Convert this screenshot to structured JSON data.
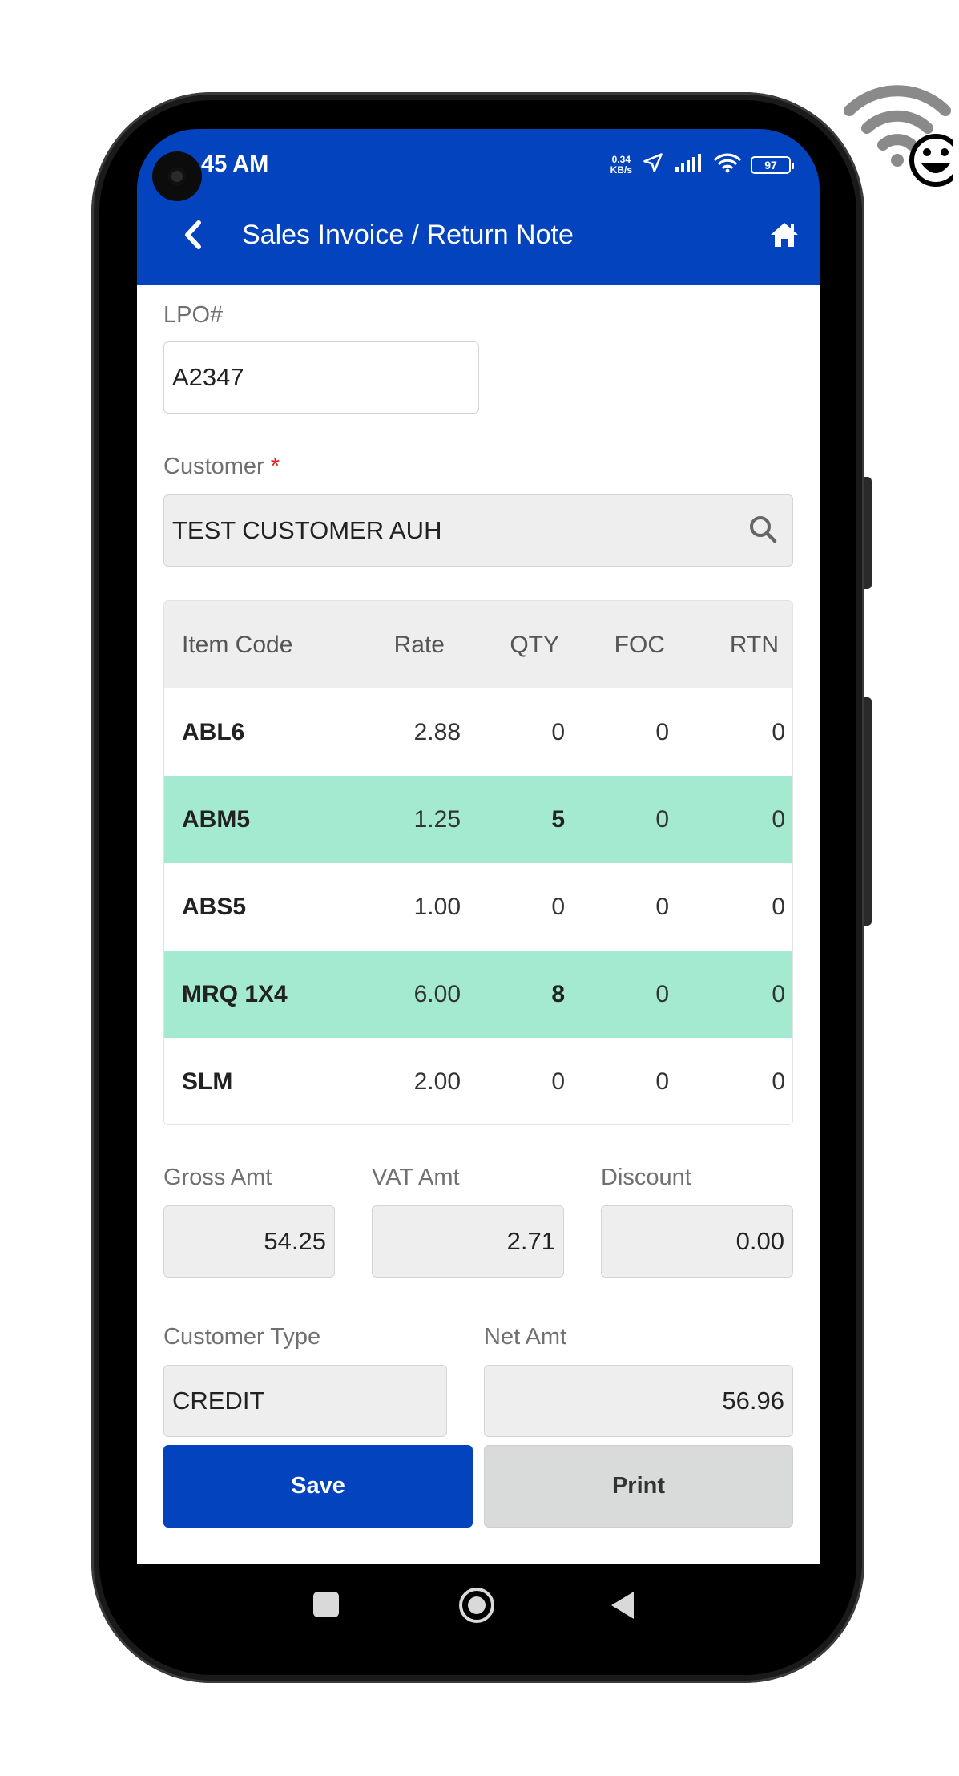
{
  "status_bar": {
    "time": "45 AM",
    "net_speed_value": "0.34",
    "net_speed_unit": "KB/s",
    "battery": "97"
  },
  "header": {
    "title": "Sales Invoice / Return Note"
  },
  "lpo": {
    "label": "LPO#",
    "value": "A2347"
  },
  "customer": {
    "label": "Customer",
    "required_mark": "*",
    "value": "TEST CUSTOMER AUH"
  },
  "table": {
    "headers": [
      "Item Code",
      "Rate",
      "QTY",
      "FOC",
      "RTN"
    ],
    "rows": [
      {
        "code": "ABL6",
        "rate": "2.88",
        "qty": "0",
        "foc": "0",
        "rtn": "0",
        "highlighted": false
      },
      {
        "code": "ABM5",
        "rate": "1.25",
        "qty": "5",
        "foc": "0",
        "rtn": "0",
        "highlighted": true
      },
      {
        "code": "ABS5",
        "rate": "1.00",
        "qty": "0",
        "foc": "0",
        "rtn": "0",
        "highlighted": false
      },
      {
        "code": "MRQ 1X4",
        "rate": "6.00",
        "qty": "8",
        "foc": "0",
        "rtn": "0",
        "highlighted": true
      },
      {
        "code": "SLM",
        "rate": "2.00",
        "qty": "0",
        "foc": "0",
        "rtn": "0",
        "highlighted": false
      }
    ]
  },
  "totals": {
    "gross_label": "Gross Amt",
    "gross_value": "54.25",
    "vat_label": "VAT Amt",
    "vat_value": "2.71",
    "discount_label": "Discount",
    "discount_value": "0.00",
    "customer_type_label": "Customer Type",
    "customer_type_value": "CREDIT",
    "net_label": "Net Amt",
    "net_value": "56.96"
  },
  "actions": {
    "save_label": "Save",
    "print_label": "Print"
  },
  "colors": {
    "primary": "#0344be",
    "highlight_row": "#a4ead1",
    "required": "#e0201b"
  }
}
